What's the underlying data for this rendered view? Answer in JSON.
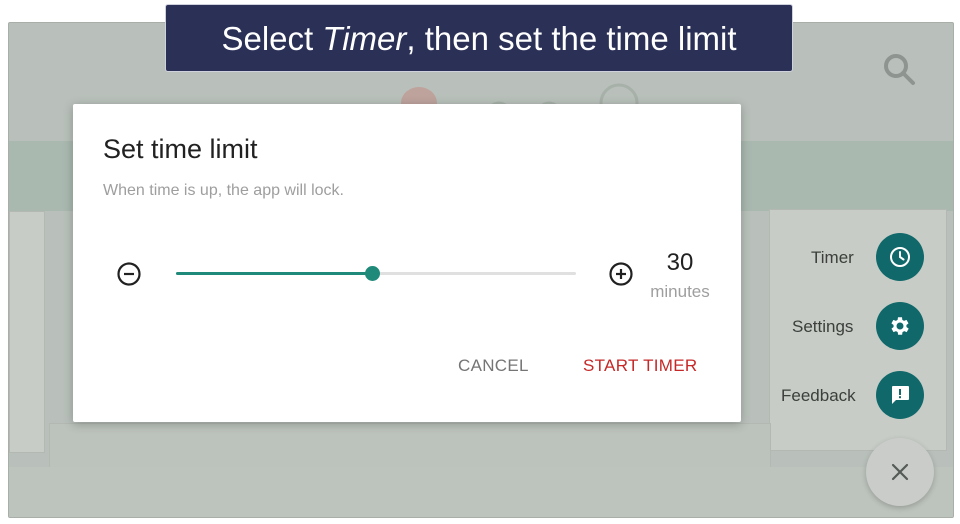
{
  "caption": {
    "before": "Select ",
    "emphasis": "Timer",
    "after": ", then set the time limit"
  },
  "dialog": {
    "title": "Set time limit",
    "subtitle": "When time is up, the app will lock.",
    "value": "30",
    "unit": "minutes",
    "slider_fraction": 0.49,
    "cancel_label": "CANCEL",
    "start_label": "START TIMER"
  },
  "speed_dial": {
    "items": [
      {
        "label": "Timer",
        "icon": "clock-icon"
      },
      {
        "label": "Settings",
        "icon": "gear-icon"
      },
      {
        "label": "Feedback",
        "icon": "feedback-icon"
      }
    ],
    "close_icon": "close-icon"
  },
  "colors": {
    "accent": "#1f8a7a",
    "fab": "#10686a",
    "danger": "#c62828",
    "caption_bg": "#2b3056",
    "scrim": "#b9c0bb"
  }
}
